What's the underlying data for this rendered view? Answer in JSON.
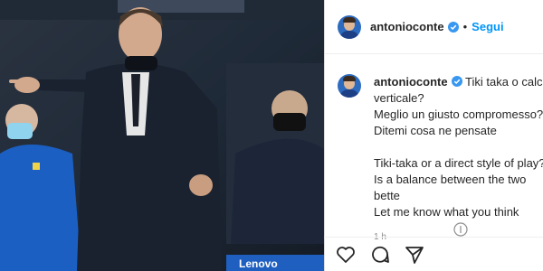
{
  "post": {
    "username": "antonioconte",
    "follow_label": "Segui",
    "caption_lines": [
      "Tiki taka o calcio",
      "verticale?",
      "Meglio un giusto compromesso?",
      "Ditemi cosa ne pensate",
      "",
      "Tiki-taka or a direct style of play?",
      "Is a balance between the two bette",
      "Let me know what you think"
    ],
    "time": "1 h"
  },
  "photo": {
    "banner_text": "Lenovo"
  },
  "icons": {
    "verified": "verified-badge-icon",
    "like": "heart-icon",
    "comment": "comment-icon",
    "share": "share-icon",
    "more": "more-icon"
  },
  "colors": {
    "follow": "#0095f6",
    "verified": "#3897f0",
    "text": "#262626",
    "muted": "#8e8e8e"
  }
}
